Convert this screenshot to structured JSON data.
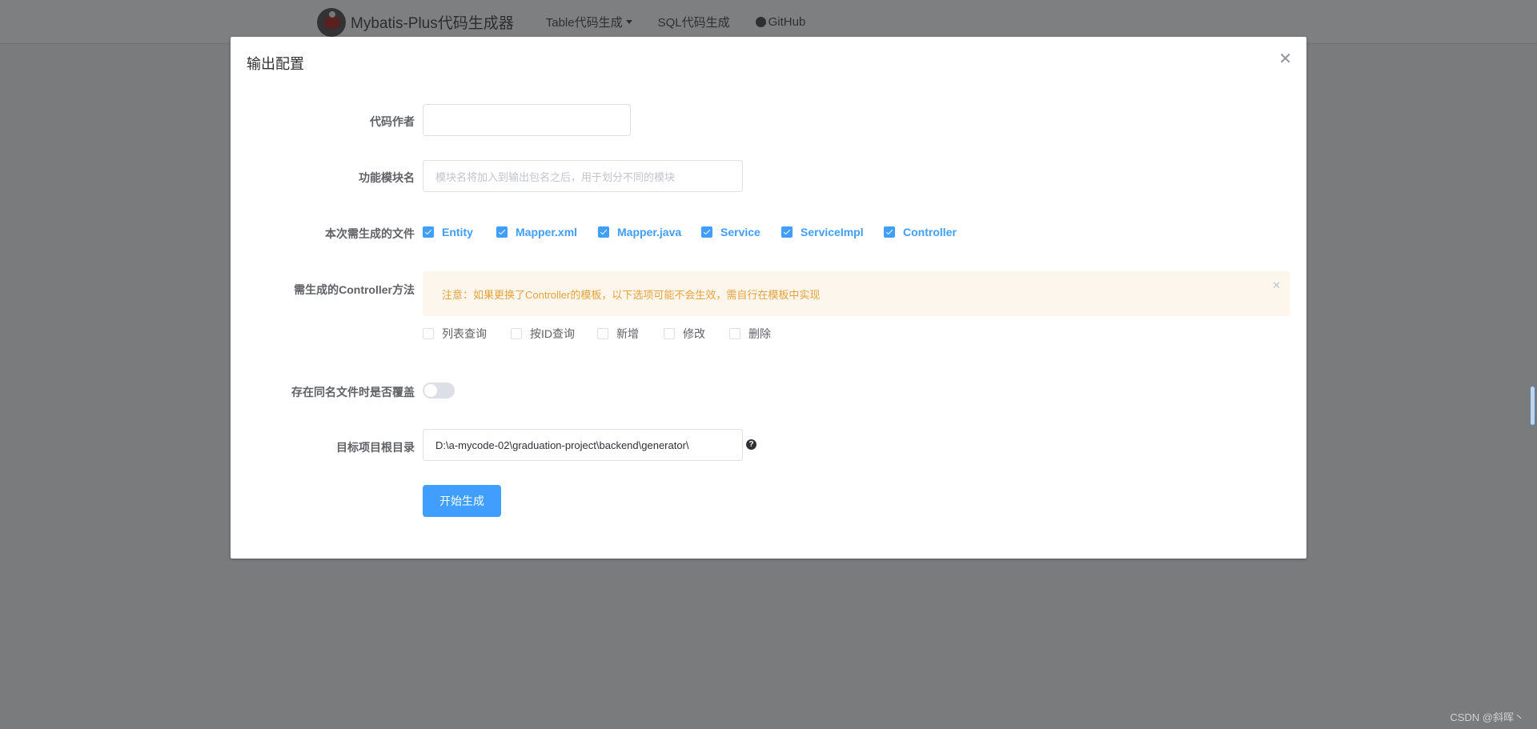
{
  "navbar": {
    "brand": "Mybatis-Plus代码生成器",
    "links": [
      {
        "label": "Table代码生成"
      },
      {
        "label": "SQL代码生成"
      },
      {
        "label": "GitHub"
      }
    ]
  },
  "modal": {
    "title": "输出配置",
    "close_icon": "close-icon",
    "author": {
      "label": "代码作者",
      "value": ""
    },
    "module": {
      "label": "功能模块名",
      "placeholder": "模块名将加入到输出包名之后，用于划分不同的模块"
    },
    "files": {
      "label": "本次需生成的文件",
      "options": [
        {
          "label": "Entity",
          "checked": true
        },
        {
          "label": "Mapper.xml",
          "checked": true
        },
        {
          "label": "Mapper.java",
          "checked": true
        },
        {
          "label": "Service",
          "checked": true
        },
        {
          "label": "ServiceImpl",
          "checked": true
        },
        {
          "label": "Controller",
          "checked": true
        }
      ]
    },
    "controller_methods": {
      "label": "需生成的Controller方法",
      "alert": "注意：如果更换了Controller的模板，以下选项可能不会生效，需自行在模板中实现",
      "options": [
        {
          "label": "列表查询",
          "checked": false
        },
        {
          "label": "按ID查询",
          "checked": false
        },
        {
          "label": "新增",
          "checked": false
        },
        {
          "label": "修改",
          "checked": false
        },
        {
          "label": "删除",
          "checked": false
        }
      ]
    },
    "overwrite": {
      "label": "存在同名文件时是否覆盖",
      "enabled": false
    },
    "target_dir": {
      "label": "目标项目根目录",
      "value": "D:\\a-mycode-02\\graduation-project\\backend\\generator\\",
      "help_icon": "question-icon"
    },
    "submit_label": "开始生成"
  },
  "watermark": "CSDN @斜晖丶",
  "colors": {
    "primary": "#409eff",
    "warning": "#e6a23c",
    "alert_bg": "#fdf6ec",
    "overlay": "#7a7b7c"
  }
}
